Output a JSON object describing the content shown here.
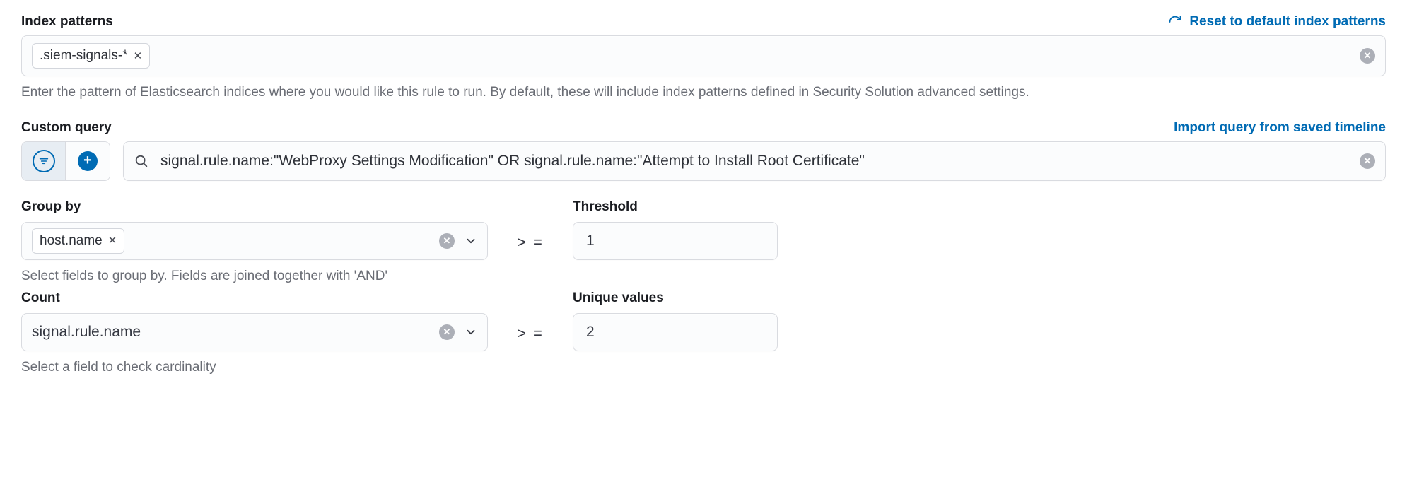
{
  "index_patterns": {
    "label": "Index patterns",
    "reset_link": "Reset to default index patterns",
    "pills": [
      ".siem-signals-*"
    ],
    "help": "Enter the pattern of Elasticsearch indices where you would like this rule to run. By default, these will include index patterns defined in Security Solution advanced settings."
  },
  "custom_query": {
    "label": "Custom query",
    "import_link": "Import query from saved timeline",
    "value": "signal.rule.name:\"WebProxy Settings Modification\"  OR signal.rule.name:\"Attempt to Install Root Certificate\""
  },
  "group_by": {
    "label": "Group by",
    "pills": [
      "host.name"
    ],
    "help": "Select fields to group by. Fields are joined together with 'AND'"
  },
  "threshold": {
    "label": "Threshold",
    "operator": "> =",
    "value": "1"
  },
  "count": {
    "label": "Count",
    "value": "signal.rule.name",
    "help": "Select a field to check cardinality"
  },
  "unique_values": {
    "label": "Unique values",
    "operator": "> =",
    "value": "2"
  }
}
